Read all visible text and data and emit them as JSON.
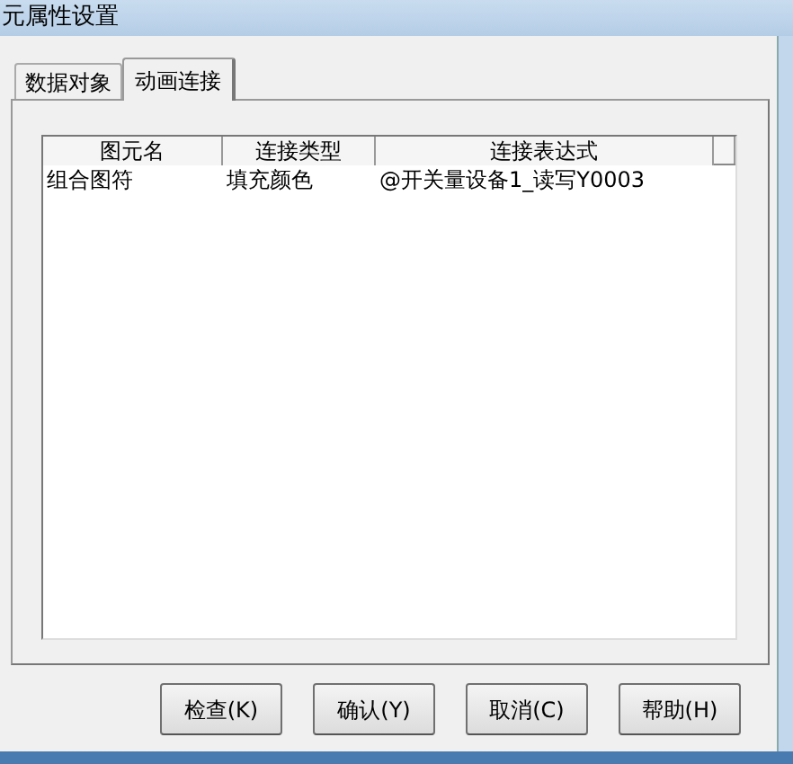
{
  "window": {
    "title": "元属性设置"
  },
  "tabs": [
    {
      "label": "数据对象",
      "selected": false
    },
    {
      "label": "动画连接",
      "selected": true
    }
  ],
  "table": {
    "columns": [
      "图元名",
      "连接类型",
      "连接表达式"
    ],
    "rows": [
      [
        "组合图符",
        "填充颜色",
        "@开关量设备1_读写Y0003"
      ]
    ]
  },
  "buttons": [
    "检查(K)",
    "确认(Y)",
    "取消(C)",
    "帮助(H)"
  ]
}
